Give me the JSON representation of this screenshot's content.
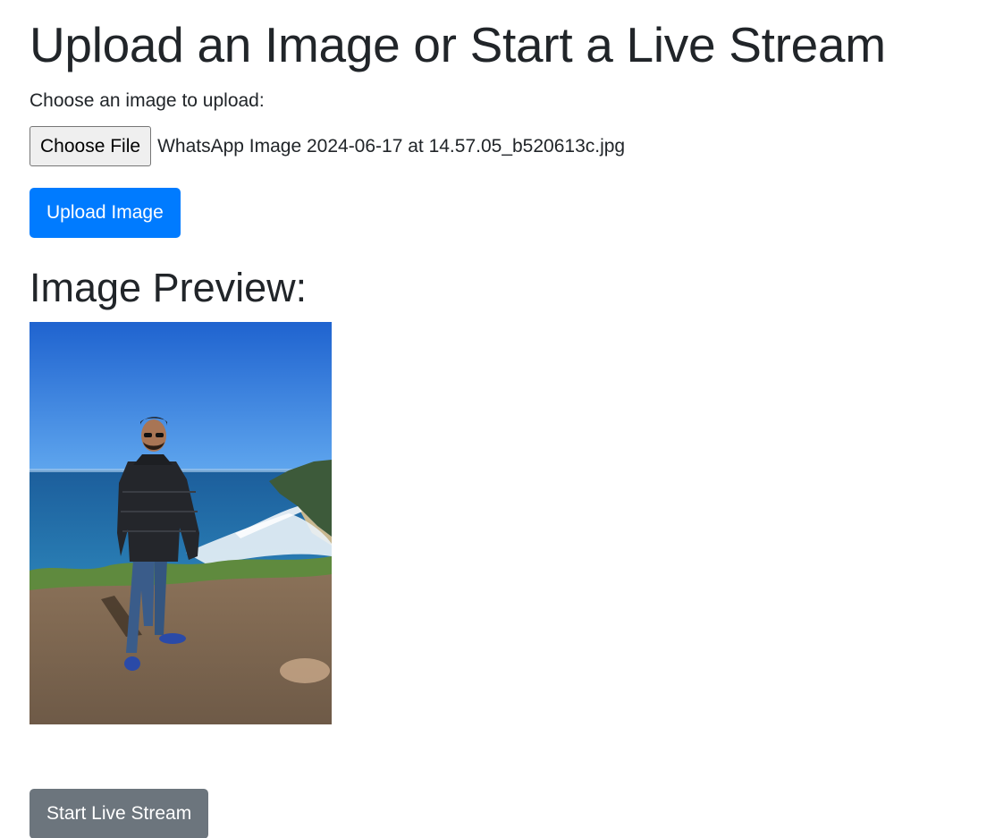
{
  "page": {
    "title": "Upload an Image or Start a Live Stream"
  },
  "upload": {
    "label": "Choose an image to upload:",
    "choose_file_label": "Choose File",
    "selected_file_name": "WhatsApp Image 2024-06-17 at 14.57.05_b520613c.jpg",
    "upload_button_label": "Upload Image"
  },
  "preview": {
    "heading": "Image Preview:"
  },
  "live_stream": {
    "button_label": "Start Live Stream"
  },
  "colors": {
    "primary": "#007bff",
    "secondary": "#6c757d",
    "text": "#212529"
  }
}
